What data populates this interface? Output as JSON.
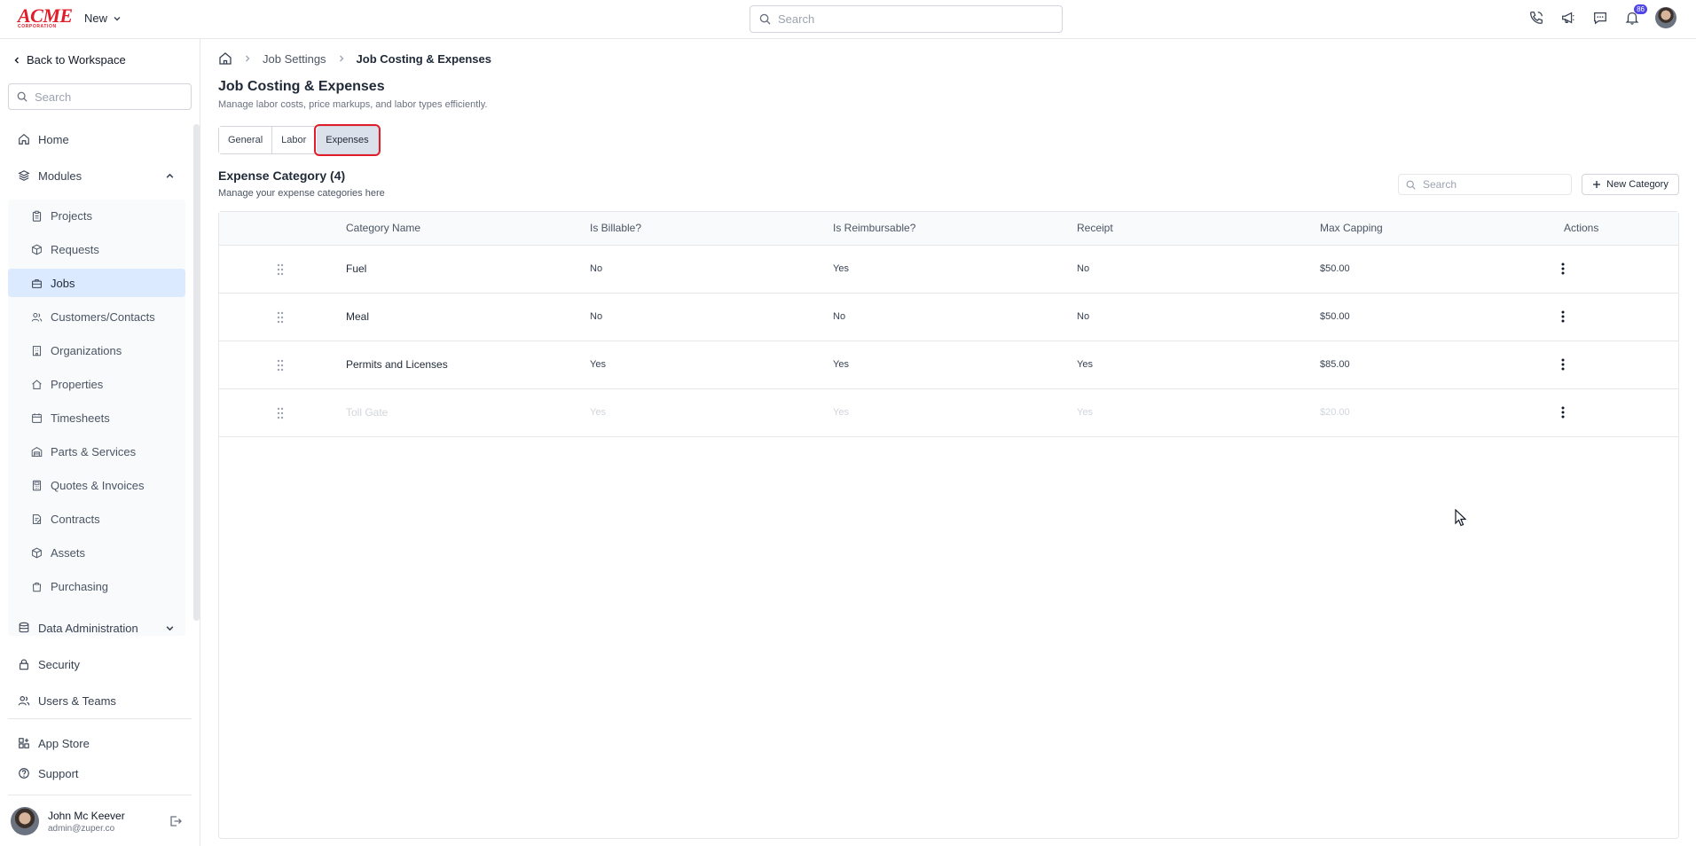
{
  "topbar": {
    "logo_text": "ACME",
    "logo_sub": "CORPORATION",
    "new_label": "New",
    "search_placeholder": "Search",
    "notification_count": "86"
  },
  "sidebar": {
    "back_label": "Back to Workspace",
    "search_placeholder": "Search",
    "home": "Home",
    "modules": "Modules",
    "module_items": [
      "Projects",
      "Requests",
      "Jobs",
      "Customers/Contacts",
      "Organizations",
      "Properties",
      "Timesheets",
      "Parts & Services",
      "Quotes & Invoices",
      "Contracts",
      "Assets",
      "Purchasing"
    ],
    "data_administration": "Data Administration",
    "security": "Security",
    "users_teams": "Users & Teams",
    "app_store": "App Store",
    "support": "Support",
    "user_name": "John Mc Keever",
    "user_email": "admin@zuper.co"
  },
  "breadcrumb": [
    "Job Settings",
    "Job Costing & Expenses"
  ],
  "page": {
    "title": "Job Costing & Expenses",
    "subtitle": "Manage labor costs, price markups, and labor types efficiently."
  },
  "tabs": [
    "General",
    "Labor",
    "Expenses"
  ],
  "section": {
    "title": "Expense Category (4)",
    "subtitle": "Manage your expense categories here",
    "search_placeholder": "Search",
    "new_category_label": "New Category"
  },
  "table": {
    "headers": [
      "Category Name",
      "Is Billable?",
      "Is Reimbursable?",
      "Receipt",
      "Max Capping",
      "Actions"
    ],
    "rows": [
      {
        "name": "Fuel",
        "billable": "No",
        "reimbursable": "Yes",
        "receipt": "No",
        "max": "$50.00"
      },
      {
        "name": "Meal",
        "billable": "No",
        "reimbursable": "No",
        "receipt": "No",
        "max": "$50.00"
      },
      {
        "name": "Permits and Licenses",
        "billable": "Yes",
        "reimbursable": "Yes",
        "receipt": "Yes",
        "max": "$85.00"
      },
      {
        "name": "Toll Gate",
        "billable": "Yes",
        "reimbursable": "Yes",
        "receipt": "Yes",
        "max": "$20.00"
      }
    ]
  }
}
